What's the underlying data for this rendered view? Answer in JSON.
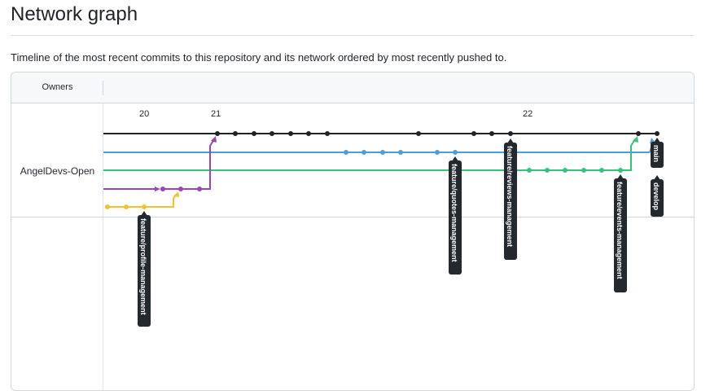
{
  "page": {
    "title": "Network graph",
    "description": "Timeline of the most recent commits to this repository and its network ordered by most recently pushed to."
  },
  "table": {
    "owners_header": "Owners",
    "owner": "AngelDevs-Open"
  },
  "timeline": {
    "ticks": [
      "20",
      "21",
      "22"
    ]
  },
  "branches": [
    {
      "name": "main",
      "color": "#1f2328"
    },
    {
      "name": "develop",
      "color": "#4a9fd8"
    },
    {
      "name": "feature/events-management",
      "color": "#35c27a"
    },
    {
      "name": "feature/profile-management",
      "color": "#9747b8"
    },
    {
      "name": "feature/profile-management",
      "color": "#f1c232"
    }
  ],
  "labels": {
    "main": "main",
    "develop": "develop",
    "quotes": "feature/quotes-management",
    "reviews": "feature/reviews-management",
    "events": "feature/events-management",
    "profile": "feature/profile-management"
  }
}
